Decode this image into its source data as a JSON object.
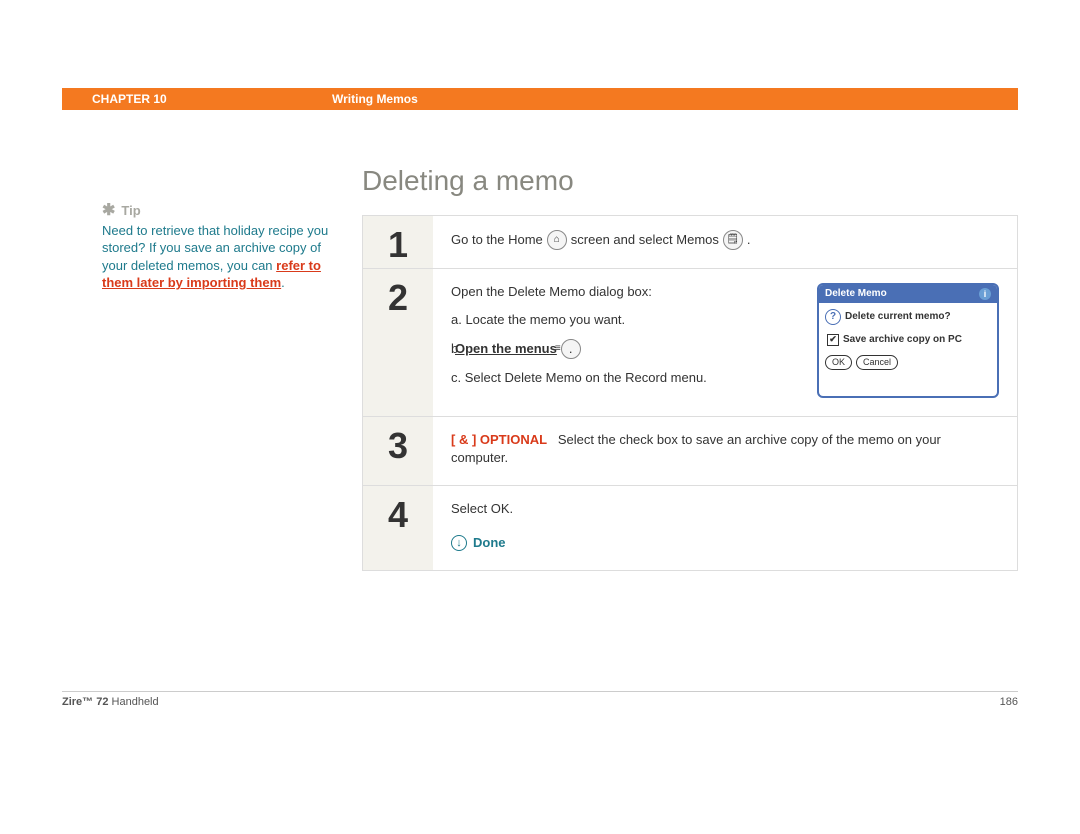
{
  "header": {
    "chapter": "CHAPTER 10",
    "title": "Writing Memos"
  },
  "page_title": "Deleting a memo",
  "tip": {
    "label": "Tip",
    "body_pre": "Need to retrieve that holiday recipe you stored? If you save an archive copy of your deleted memos, you can ",
    "link": "refer to them later by importing them",
    "body_post": "."
  },
  "steps": {
    "s1": {
      "num": "1",
      "pre": "Go to the Home",
      "mid": "screen and select Memos",
      "post": "."
    },
    "s2": {
      "num": "2",
      "intro": "Open the Delete Memo dialog box:",
      "a": "a.  Locate the memo you want.",
      "b_pre": "b.  ",
      "b_link": "Open the menus",
      "b_post": ".",
      "c": "c.  Select Delete Memo on the Record menu."
    },
    "s3": {
      "num": "3",
      "tag": "[ & ]  OPTIONAL",
      "text": "Select the check box to save an archive copy of the memo on your computer."
    },
    "s4": {
      "num": "4",
      "text": "Select OK.",
      "done": "Done"
    }
  },
  "dialog": {
    "title": "Delete Memo",
    "question": "Delete current memo?",
    "checkbox": "Save archive copy on PC",
    "ok": "OK",
    "cancel": "Cancel"
  },
  "footer": {
    "product_bold": "Zire™ 72",
    "product_rest": " Handheld",
    "page": "186"
  }
}
